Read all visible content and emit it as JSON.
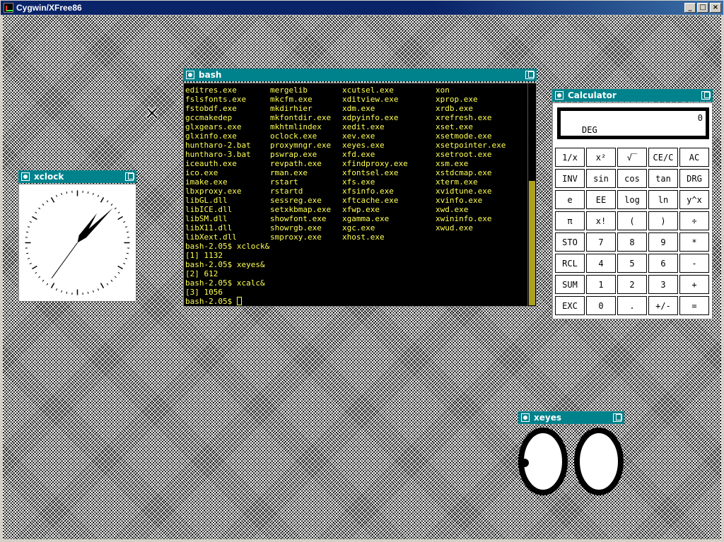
{
  "outer_window": {
    "title": "Cygwin/XFree86",
    "buttons": {
      "minimize": "_",
      "maximize": "□",
      "close": "×"
    }
  },
  "bash": {
    "title": "bash",
    "columns": [
      [
        "editres.exe",
        "fslsfonts.exe",
        "fstobdf.exe",
        "gccmakedep",
        "glxgears.exe",
        "glxinfo.exe",
        "huntharo-2.bat",
        "huntharo-3.bat",
        "iceauth.exe",
        "ico.exe",
        "imake.exe",
        "lbxproxy.exe",
        "libGL.dll",
        "libICE.dll",
        "libSM.dll",
        "libX11.dll",
        "libXext.dll"
      ],
      [
        "mergelib",
        "mkcfm.exe",
        "mkdirhier",
        "mkfontdir.exe",
        "mkhtmlindex",
        "oclock.exe",
        "proxymngr.exe",
        "pswrap.exe",
        "revpath.exe",
        "rman.exe",
        "rstart",
        "rstartd",
        "sessreg.exe",
        "setxkbmap.exe",
        "showfont.exe",
        "showrgb.exe",
        "smproxy.exe"
      ],
      [
        "xcutsel.exe",
        "xditview.exe",
        "xdm.exe",
        "xdpyinfo.exe",
        "xedit.exe",
        "xev.exe",
        "xeyes.exe",
        "xfd.exe",
        "xfindproxy.exe",
        "xfontsel.exe",
        "xfs.exe",
        "xfsinfo.exe",
        "xftcache.exe",
        "xfwp.exe",
        "xgamma.exe",
        "xgc.exe",
        "xhost.exe"
      ],
      [
        "xon",
        "xprop.exe",
        "xrdb.exe",
        "xrefresh.exe",
        "xset.exe",
        "xsetmode.exe",
        "xsetpointer.exe",
        "xsetroot.exe",
        "xsm.exe",
        "xstdcmap.exe",
        "xterm.exe",
        "xvidtune.exe",
        "xvinfo.exe",
        "xwd.exe",
        "xwininfo.exe",
        "xwud.exe",
        ""
      ]
    ],
    "lines": [
      "bash-2.05$ xclock&",
      "[1] 1132",
      "bash-2.05$ xeyes&",
      "[2] 612",
      "bash-2.05$ xcalc&",
      "[3] 1056"
    ],
    "prompt": "bash-2.05$ "
  },
  "xclock": {
    "title": "xclock",
    "time": {
      "hour": 1,
      "minute": 7,
      "second": 36
    }
  },
  "calculator": {
    "title": "Calculator",
    "display_value": "0",
    "angle_mode": "DEG",
    "keys": [
      "1/x",
      "x²",
      "√‾",
      "CE/C",
      "AC",
      "INV",
      "sin",
      "cos",
      "tan",
      "DRG",
      "e",
      "EE",
      "log",
      "ln",
      "y^x",
      "π",
      "x!",
      "(",
      ")",
      "÷",
      "STO",
      "7",
      "8",
      "9",
      "*",
      "RCL",
      "4",
      "5",
      "6",
      "-",
      "SUM",
      "1",
      "2",
      "3",
      "+",
      "EXC",
      "0",
      ".",
      "+/-",
      "="
    ]
  },
  "xeyes": {
    "title": "xeyes"
  },
  "icons": {
    "window_menu": "window-menu-icon",
    "window_maximize": "maximize-icon",
    "pointer": "x-cursor-icon"
  },
  "colors": {
    "title_bar": "#00828c",
    "terminal_text": "#ffff55",
    "terminal_bg": "#000000"
  }
}
